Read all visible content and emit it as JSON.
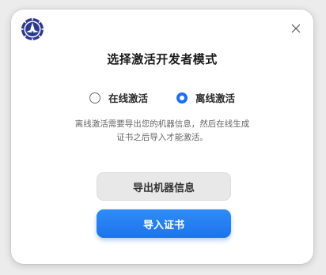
{
  "dialog": {
    "title": "选择激活开发者模式",
    "modes": [
      {
        "label": "在线激活",
        "selected": false
      },
      {
        "label": "离线激活",
        "selected": true
      }
    ],
    "description_line1": "离线激活需要导出您的机器信息，然后在线生成",
    "description_line2": "证书之后导入才能激活。",
    "export_button_label": "导出机器信息",
    "import_button_label": "导入证书"
  },
  "colors": {
    "accent": "#1e73ee",
    "logo": "#2b3a8f"
  },
  "icons": {
    "app": "app-logo-icon",
    "close": "close-icon"
  }
}
